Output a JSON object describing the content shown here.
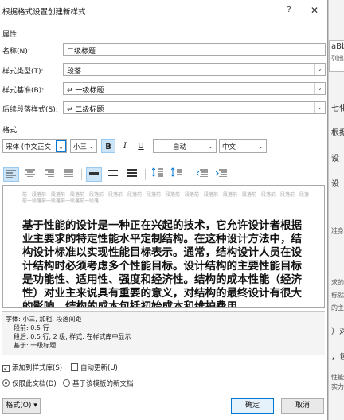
{
  "window": {
    "title": "根据格式设置创建新样式",
    "help_glyph": "?",
    "close_glyph": "✕"
  },
  "properties": {
    "section_label": "属性",
    "name_label": "名称(N):",
    "name_value": "二级标题",
    "type_label": "样式类型(T):",
    "type_value": "段落",
    "based_on_label": "样式基准(B):",
    "based_on_value": "↵ 一级标题",
    "next_label": "后续段落样式(S):",
    "next_value": "↵ 二级标题"
  },
  "format": {
    "section_label": "格式",
    "font_value": "宋体 (中文正文",
    "size_value": "小三",
    "bold_label": "B",
    "italic_label": "I",
    "underline_label": "U",
    "color_value": "自动",
    "lang_value": "中文",
    "dropdown_glyph": "⌄"
  },
  "preview": {
    "prev_text": "前一段落前一段落前一段落前一段落前一段落前一段落前一段落前一段落前一段落前一段落前一段落前一段落前一段落前一段落前一段落前一段落前一段落前一段落前一段落",
    "main_text": "基于性能的设计是一种正在兴起的技术，它允许设计者根据业主要求的特定性能水平定制结构。在这种设计方法中，结构设计标准以实现性能目标表示。通常，结构设计人员在设计结构时必须考虑多个性能目标。设计结构的主要性能目标是功能性、适用性、强度和经济性。结构的成本性能（经济性）对业主来说具有重要的意义，对结构的最终设计有很大的影响，结构的成本包括初始成本和维护费用，",
    "accent_color": "#0078d7"
  },
  "description": {
    "line1": "字体: 小三, 加粗, 段落间距",
    "line2": "段前: 0.5 行",
    "line3": "段后: 0.5 行, 2 级, 样式: 在样式库中显示",
    "line4": "基于: 一级标题"
  },
  "options": {
    "add_to_gallery": "添加到样式库(S)",
    "auto_update": "自动更新(U)",
    "only_this_doc": "仅限此文档(D)",
    "new_docs": "基于该模板的新文档",
    "add_to_gallery_checked": true,
    "auto_update_checked": false
  },
  "buttons": {
    "format": "格式(O) ▾",
    "ok": "确定",
    "cancel": "取消"
  },
  "background": {
    "frag1": "aBb",
    "frag2": "列出",
    "frag3": "七化",
    "frag4": "根据",
    "frag5": "设",
    "frag6": "设",
    "frag7": "准身",
    "frag8": "求的",
    "frag9": "标就",
    "frag10": "的主",
    "frag11": "）对",
    "frag12": "，包",
    "frag13": "性能",
    "frag14": "实力"
  }
}
